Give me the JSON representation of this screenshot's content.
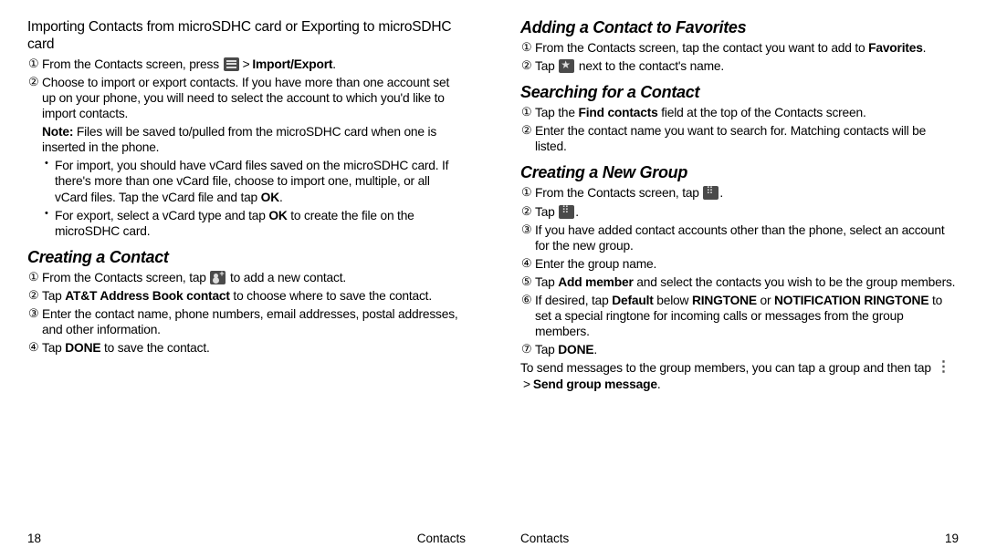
{
  "left": {
    "heading": "Importing Contacts from microSDHC card or Exporting to microSDHC card",
    "s1_a": "From the Contacts screen, press ",
    "s1_b": "Import/Export",
    "gt": ">",
    "dot": ".",
    "s2": "Choose to import or export contacts. If you have more than one account set up on your phone, you will need to select the account to which you'd like to import contacts.",
    "note_label": "Note:",
    "note_text": " Files will be saved to/pulled from the microSDHC card when one is inserted in the phone.",
    "b1_a": "For import, you should have vCard files saved on the microSDHC card. If there's more than one vCard file, choose to import one, multiple, or all vCard files. Tap the vCard file and tap ",
    "b1_b": "OK",
    "b2_a": "For export, select a vCard type and tap ",
    "b2_b": "OK",
    "b2_c": " to create the file on the microSDHC card.",
    "h2": "Creating a Contact",
    "c1_a": "From the Contacts screen, tap ",
    "c1_b": " to add a new contact.",
    "c2_a": "Tap ",
    "c2_b": "AT&T Address Book contact",
    "c2_c": " to choose where to save the contact.",
    "c3": "Enter the contact name, phone numbers, email addresses, postal addresses, and other information.",
    "c4_a": "Tap ",
    "c4_b": "DONE",
    "c4_c": " to save the contact.",
    "page_num": "18",
    "footer_label": "Contacts"
  },
  "right": {
    "h1": "Adding a Contact to Favorites",
    "f1_a": "From the Contacts screen, tap the contact you want to add to ",
    "f1_b": "Favorites",
    "f2_a": "Tap ",
    "f2_b": " next to the contact's name.",
    "h2": "Searching for a Contact",
    "s1_a": "Tap the ",
    "s1_b": "Find contacts",
    "s1_c": " field at the top of the Contacts screen.",
    "s2": "Enter the contact name you want to search for. Matching contacts will be listed.",
    "h3": "Creating a New Group",
    "g1_a": "From the Contacts screen, tap ",
    "g2_a": "Tap ",
    "g3": "If you have added contact accounts other than the phone, select an account for the new group.",
    "g4": "Enter the group name.",
    "g5_a": "Tap ",
    "g5_b": "Add member",
    "g5_c": " and select the contacts you wish to be the group members.",
    "g6_a": "If desired, tap ",
    "g6_b": "Default",
    "g6_c": " below ",
    "g6_d": "RINGTONE",
    "g6_e": " or ",
    "g6_f": "NOTIFICATION RINGTONE",
    "g6_g": " to set a special ringtone for incoming calls or messages from the group members.",
    "g7_a": "Tap ",
    "g7_b": "DONE",
    "p1_a": "To send messages to the group members, you can tap a group and then tap ",
    "p1_b": "Send group message",
    "dot": ".",
    "gt": ">",
    "page_num": "19",
    "footer_label": "Contacts"
  }
}
